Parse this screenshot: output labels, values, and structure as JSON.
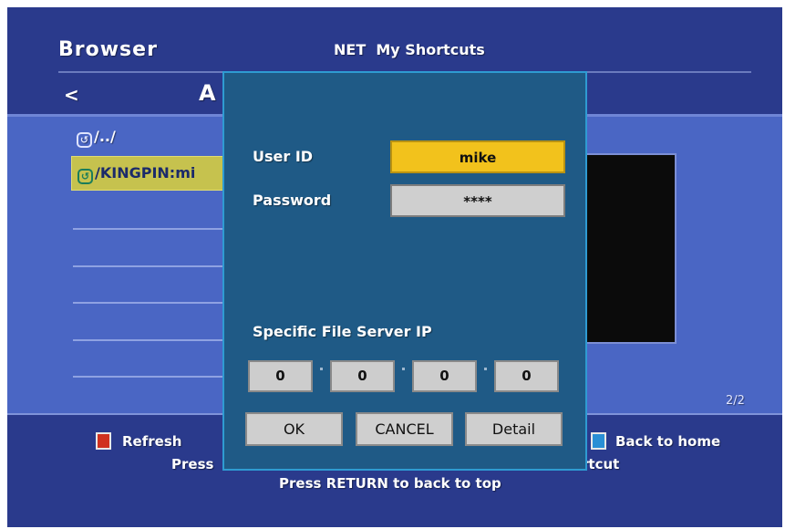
{
  "header": {
    "title": "Browser",
    "section": "NET  My Shortcuts",
    "nav_prev": "<",
    "location": "A"
  },
  "list": {
    "items": [
      {
        "icon": "shortcut-icon",
        "label": "/../"
      },
      {
        "icon": "shortcut-icon",
        "label": "/KINGPIN:mi"
      }
    ],
    "page": "2/2"
  },
  "footer": {
    "refresh_label": "Refresh",
    "press_partial": "Press",
    "back_home_label": "Back to home",
    "shortcut_partial": "rtcut",
    "return_hint": "Press RETURN to back to top"
  },
  "dialog": {
    "user_id_label": "User ID",
    "user_id_value": "mike",
    "password_label": "Password",
    "password_value": "****",
    "server_ip_label": "Specific File Server IP",
    "ip": [
      "0",
      "0",
      "0",
      "0"
    ],
    "ok_label": "OK",
    "cancel_label": "CANCEL",
    "detail_label": "Detail"
  },
  "colors": {
    "background": "#2a3a8c",
    "list_band": "#4a66c4",
    "dialog": "#1f5a86",
    "dialog_border": "#2f9bd2",
    "selected_field": "#f2c21c",
    "selected_item": "#c6c24e",
    "red_key": "#d0311f",
    "blue_key": "#2a8fd5"
  }
}
